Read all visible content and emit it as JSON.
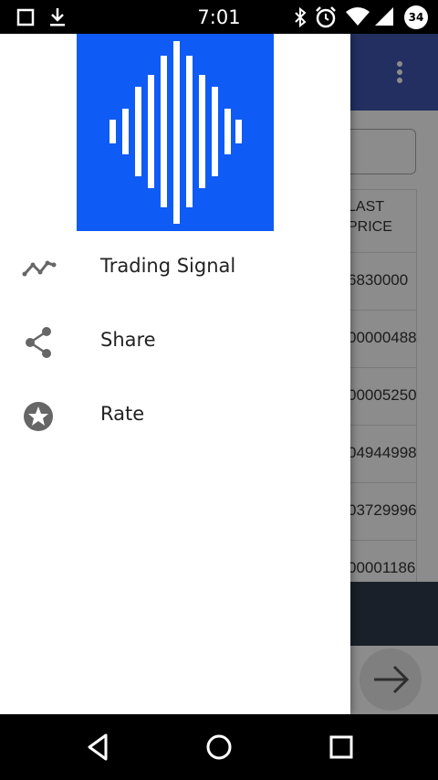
{
  "status_bar": {
    "time": "7:01",
    "battery_level": "34",
    "icons": [
      "square-notification-icon",
      "download-icon",
      "bluetooth-icon",
      "alarm-icon",
      "wifi-icon",
      "signal-icon",
      "battery-icon"
    ]
  },
  "drawer": {
    "logo": "sound-wave-logo",
    "logo_color": "#0f5bf5",
    "items": [
      {
        "label": "Trading Signal",
        "icon": "trend-line-icon"
      },
      {
        "label": "Share",
        "icon": "share-icon"
      },
      {
        "label": "Rate",
        "icon": "star-icon"
      }
    ]
  },
  "background_app": {
    "toolbar_color": "#3e56b0",
    "table_header": "LAST PRICE",
    "header_line1": "LAST",
    "header_line2": "PRICE",
    "rows": [
      "6830000",
      "00000488",
      "00005250",
      "04944998",
      "03729996",
      "00001186"
    ]
  },
  "nav_bar": {
    "buttons": [
      "back-button",
      "home-button",
      "recents-button"
    ]
  }
}
